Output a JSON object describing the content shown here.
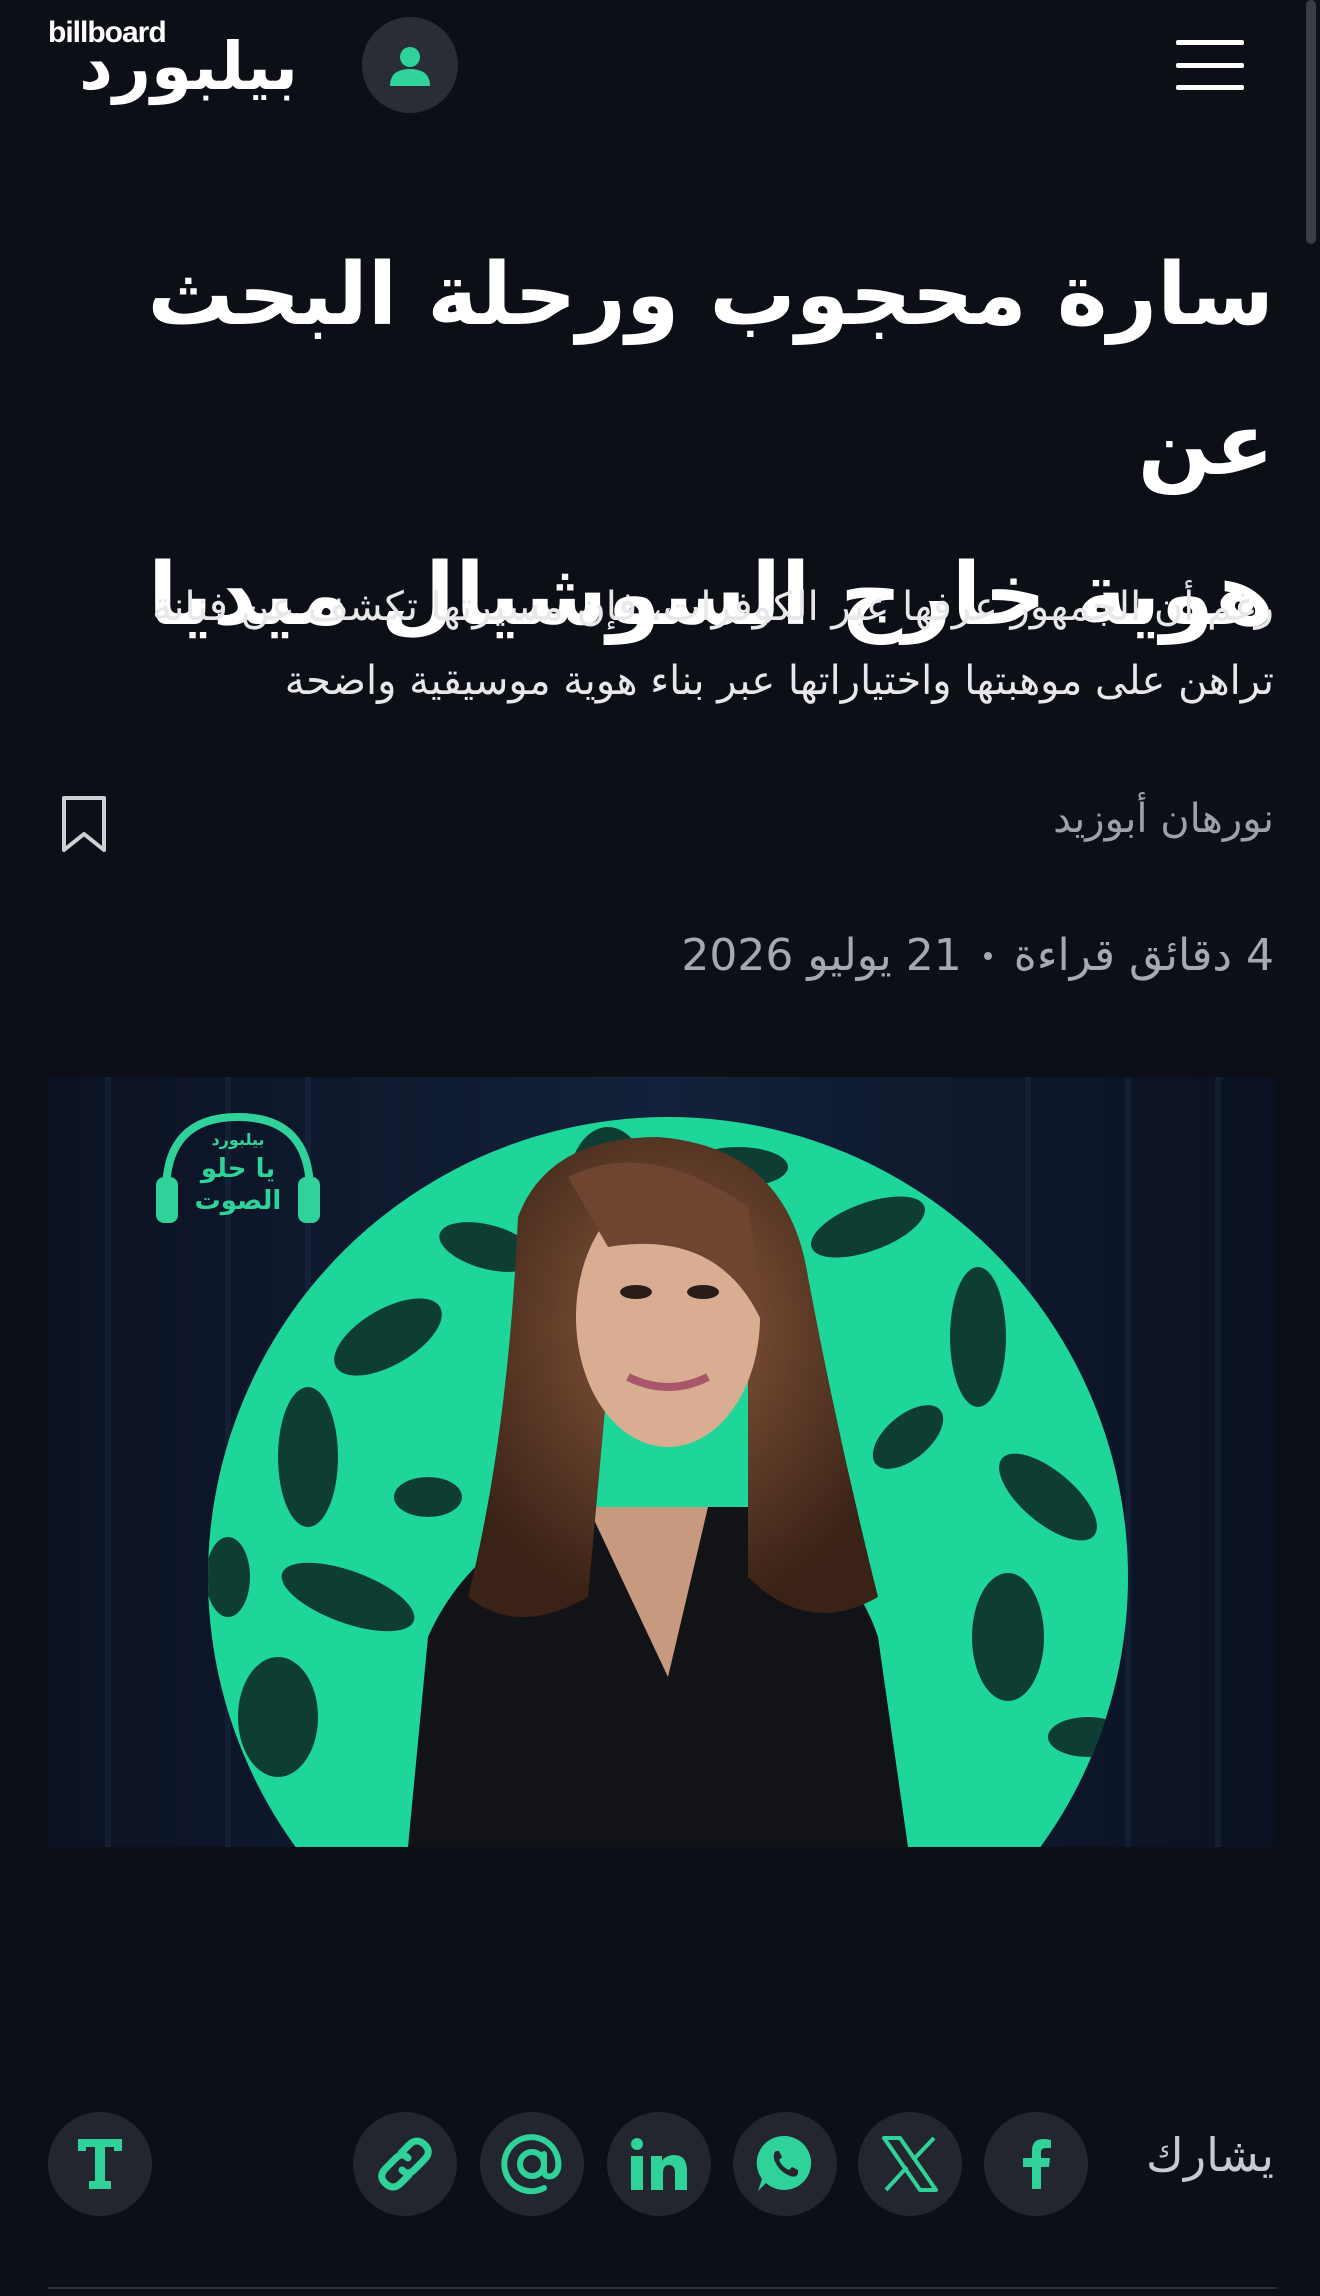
{
  "header": {
    "logo_latin": "billboard",
    "logo_arabic": "بيلبورد",
    "user_icon": "user-icon",
    "menu_icon": "hamburger-menu-icon"
  },
  "article": {
    "title_line1": "سارة محجوب ورحلة البحث عن",
    "title_line2": "هوية خارج السوشيال ميديا",
    "summary_line1": "رغم أن الجمهور عرفها عبر الكوفرات، فإن مسيرتها تكشف عن فنانة",
    "summary_line2": "تراهن على موهبتها واختياراتها عبر بناء هوية موسيقية واضحة",
    "author": "نورهان أبوزيد",
    "read_time": "4 دقائق قراءة",
    "date": "21 يوليو 2026",
    "bookmark_icon": "bookmark-icon"
  },
  "hero": {
    "badge_line1": "بيلبورد",
    "badge_line2": "يا حلو",
    "badge_line3": "الصوت"
  },
  "share": {
    "label": "يشارك",
    "icons": [
      "facebook-icon",
      "x-icon",
      "whatsapp-icon",
      "linkedin-icon",
      "email-icon",
      "link-icon",
      "text-size-icon"
    ]
  },
  "colors": {
    "background": "#0d0f17",
    "accent": "#2fd39a",
    "button_bg": "#23262f"
  }
}
